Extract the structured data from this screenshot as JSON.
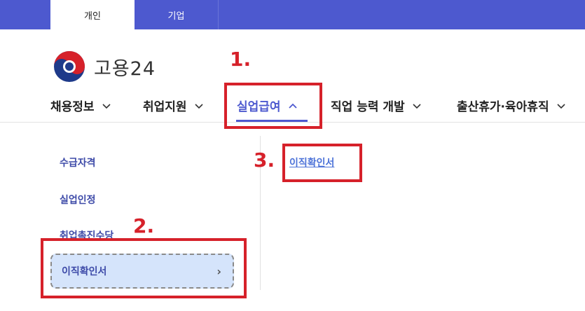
{
  "top_tabs": [
    {
      "label": "개인",
      "active": true
    },
    {
      "label": "기업",
      "active": false
    }
  ],
  "logo": {
    "text": "고용24",
    "icon": "taeguk-logo-icon"
  },
  "gnb": [
    {
      "label": "채용정보",
      "icon": "chevron-down-icon"
    },
    {
      "label": "취업지원",
      "icon": "chevron-down-icon"
    },
    {
      "label": "실업급여",
      "icon": "chevron-up-icon",
      "active": true
    },
    {
      "label": "직업 능력 개발",
      "icon": "chevron-down-icon"
    },
    {
      "label": "출산휴가·육아휴직",
      "icon": "chevron-down-icon"
    }
  ],
  "submenu": {
    "items": [
      "수급자격",
      "실업인정",
      "취업촉진수당"
    ],
    "active_item": "이직확인서",
    "active_arrow": "›"
  },
  "submenu_right": {
    "item": "이직확인서"
  },
  "annotations": [
    "1.",
    "2.",
    "3."
  ],
  "colors": {
    "brand": "#4d59cf",
    "annotation": "#d6212a",
    "active_bg": "#d5e4fb"
  }
}
